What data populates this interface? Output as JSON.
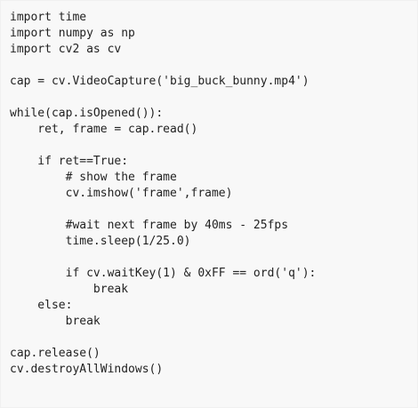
{
  "code": {
    "lines": [
      "import time",
      "import numpy as np",
      "import cv2 as cv",
      "",
      "cap = cv.VideoCapture('big_buck_bunny.mp4')",
      "",
      "while(cap.isOpened()):",
      "    ret, frame = cap.read()",
      "",
      "    if ret==True:",
      "        # show the frame",
      "        cv.imshow('frame',frame)",
      "",
      "        #wait next frame by 40ms - 25fps",
      "        time.sleep(1/25.0)",
      "",
      "        if cv.waitKey(1) & 0xFF == ord('q'):",
      "            break",
      "    else:",
      "        break",
      "",
      "cap.release()",
      "cv.destroyAllWindows()"
    ]
  }
}
